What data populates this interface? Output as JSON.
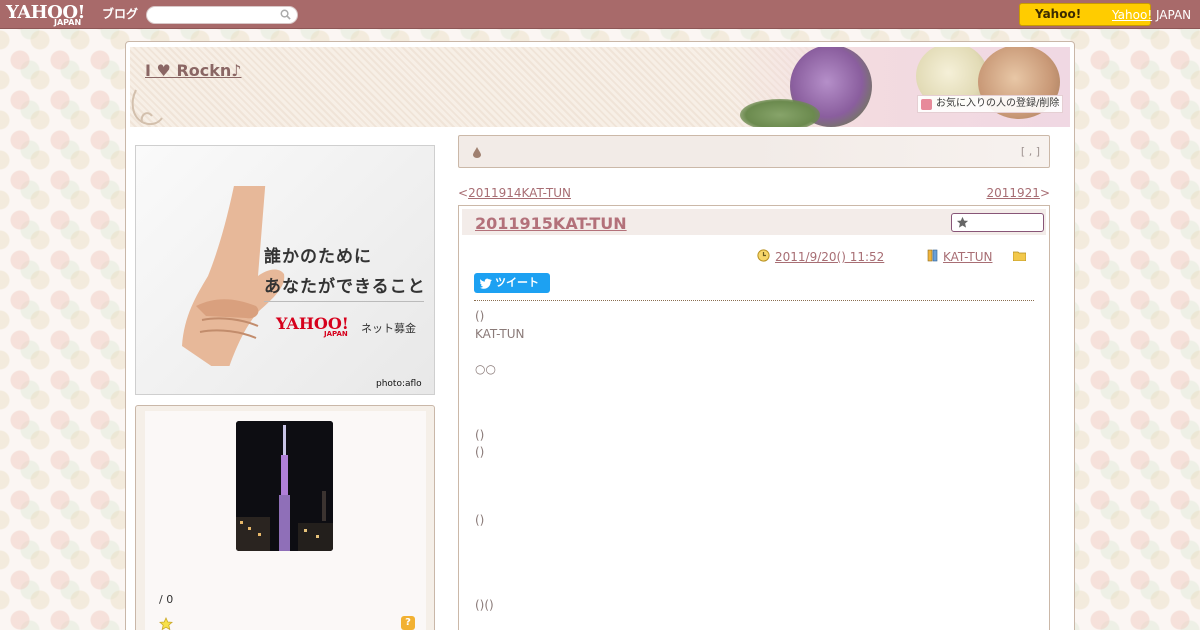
{
  "topbar": {
    "logo_yahoo": "YAHOO!",
    "logo_japan": "JAPAN",
    "logo_blog": "ブログ",
    "search_placeholder": "",
    "yahoo_button": "Yahoo!",
    "yahoo_japan_link_a": "Yahoo!",
    "yahoo_japan_link_b": " JAPAN"
  },
  "blog": {
    "title": "I ♥ Rockn♪",
    "favorite_link": "お気に入りの人の登録/削除"
  },
  "ad": {
    "line1": "誰かのために",
    "line2": "あなたができること",
    "brand": "YAHOO!",
    "brand_sub": "JAPAN",
    "service": "ネット募金",
    "credit": "photo:aflo"
  },
  "profile": {
    "count_text": "/ 0",
    "help_label": "?"
  },
  "category_bar": {
    "bracket_text": "[ , ]"
  },
  "nav": {
    "prev_arrow": "<",
    "prev_label": "2011914KAT-TUN",
    "next_label": "2011921",
    "next_arrow": ">"
  },
  "article": {
    "title": "2011915KAT-TUN",
    "date": "2011/9/20()  11:52",
    "category": "KAT-TUN",
    "tweet_label": "ツイート",
    "body": [
      "()",
      "KAT-TUN",
      "○○",
      "()",
      "()",
      "()",
      "()()"
    ]
  },
  "colors": {
    "topbar": "#a86a6a",
    "link": "#a86e74",
    "title": "#b3717a",
    "tweet": "#1da1f2",
    "yahoo_button": "#ffcc00"
  }
}
